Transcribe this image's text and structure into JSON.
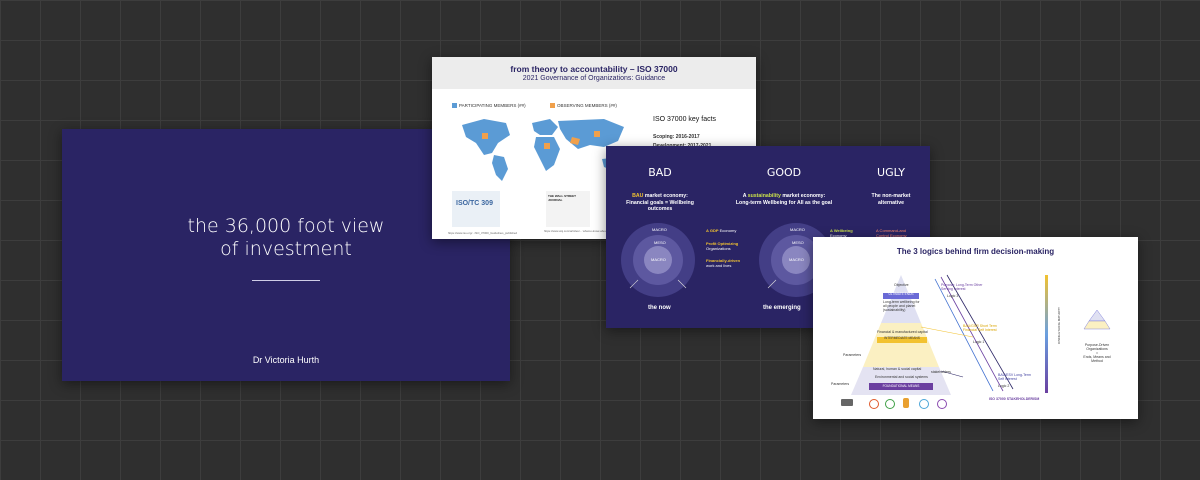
{
  "slide1": {
    "title_line1": "the 36,000 foot view",
    "title_line2": "of investment",
    "author": "Dr Victoria Hurth"
  },
  "slide2": {
    "title": "from theory to accountability – ISO 37000",
    "subtitle": "2021 Governance of Organizations: Guidance",
    "legend_participating": "PARTICIPATING MEMBERS (##)",
    "legend_observing": "OBSERVING MEMBERS (##)",
    "key_facts_title": "ISO 37000 key facts",
    "key_fact_1": "Scoping: 2016-2017",
    "key_fact_2": "Development: 2017-2021",
    "thumb1_label": "ISO/TC 309",
    "thumb2_label": "THE WALL STREET JOURNAL",
    "caption1": "https://www.iso.org/...ISO_37000_Guidelines_published",
    "caption2": "https://www.wsj.com/articles/... what-to-know-about-the-first-global-standard",
    "colors": {
      "participating": "#5b9bd5",
      "observing": "#f0a04b",
      "header_bg": "#ececec"
    }
  },
  "slide3": {
    "bad": {
      "title": "BAD",
      "desc_pre": "",
      "desc_hl": "BAU",
      "desc_post": " market economy:",
      "desc2": "Financial goals = Wellbeing",
      "desc3": "outcomes"
    },
    "good": {
      "title": "GOOD",
      "desc_pre": "A ",
      "desc_hl": "sustainability",
      "desc_post": " market economy:",
      "desc2": "Long-term Wellbeing for All as the goal"
    },
    "ugly": {
      "title": "UGLY",
      "desc2": "The non-market",
      "desc3": "alternative"
    },
    "circles": {
      "macro": "MACRO",
      "meso": "MESO",
      "micro": "MACRO"
    },
    "labels_left": {
      "l1_hl": "A GDP",
      "l1": " Economy",
      "l2_hl": "Profit Optimizing",
      "l2": "Organizations",
      "l3_hl": "Financially-driven",
      "l3": "work and lives"
    },
    "labels_right": {
      "l1_hl": "A Wellbeing",
      "l1": "Economy"
    },
    "labels_ugly": {
      "l1": "A Command-and",
      "l2": "Control Economy"
    },
    "bottom_now": "the now",
    "bottom_emerging": "the emerging"
  },
  "slide4": {
    "title": "The 3 logics behind firm decision-making",
    "objective": "Objective",
    "ultimate": "ULTIMATE ENDS",
    "ultimate_sub": "Long-term wellbeing for all people and planet (sustainability)",
    "intermediate": "INTERMEDIATE MEANS",
    "intermediate_sub": "Financial & manufactured capital",
    "foundational": "FOUNDATIONAL MEANS",
    "foundational_sub1": "Natural, human & social capital",
    "foundational_sub2": "Environmental and social systems",
    "parameters1": "Parameters",
    "parameters2": "Parameters",
    "stakeholders": "stakeholders",
    "logic3": "Logic 3",
    "logic3_desc": "Purpose: Long-Term Other Serving Interest",
    "logic1": "Logic 1",
    "logic1_desc": "BAU/GSR Short Term Financial Self Interest",
    "logic2": "Logic 2",
    "logic2_desc": "BAU/ESV Long-Term Self Interest",
    "iso": "ISO 37000 STAKEHOLDERISM",
    "vertical": "RISING ETHICAL MATURITY",
    "right1": "Purpose-Driven Organizations",
    "right2": "=",
    "right3": "Ends, Means and Method"
  }
}
